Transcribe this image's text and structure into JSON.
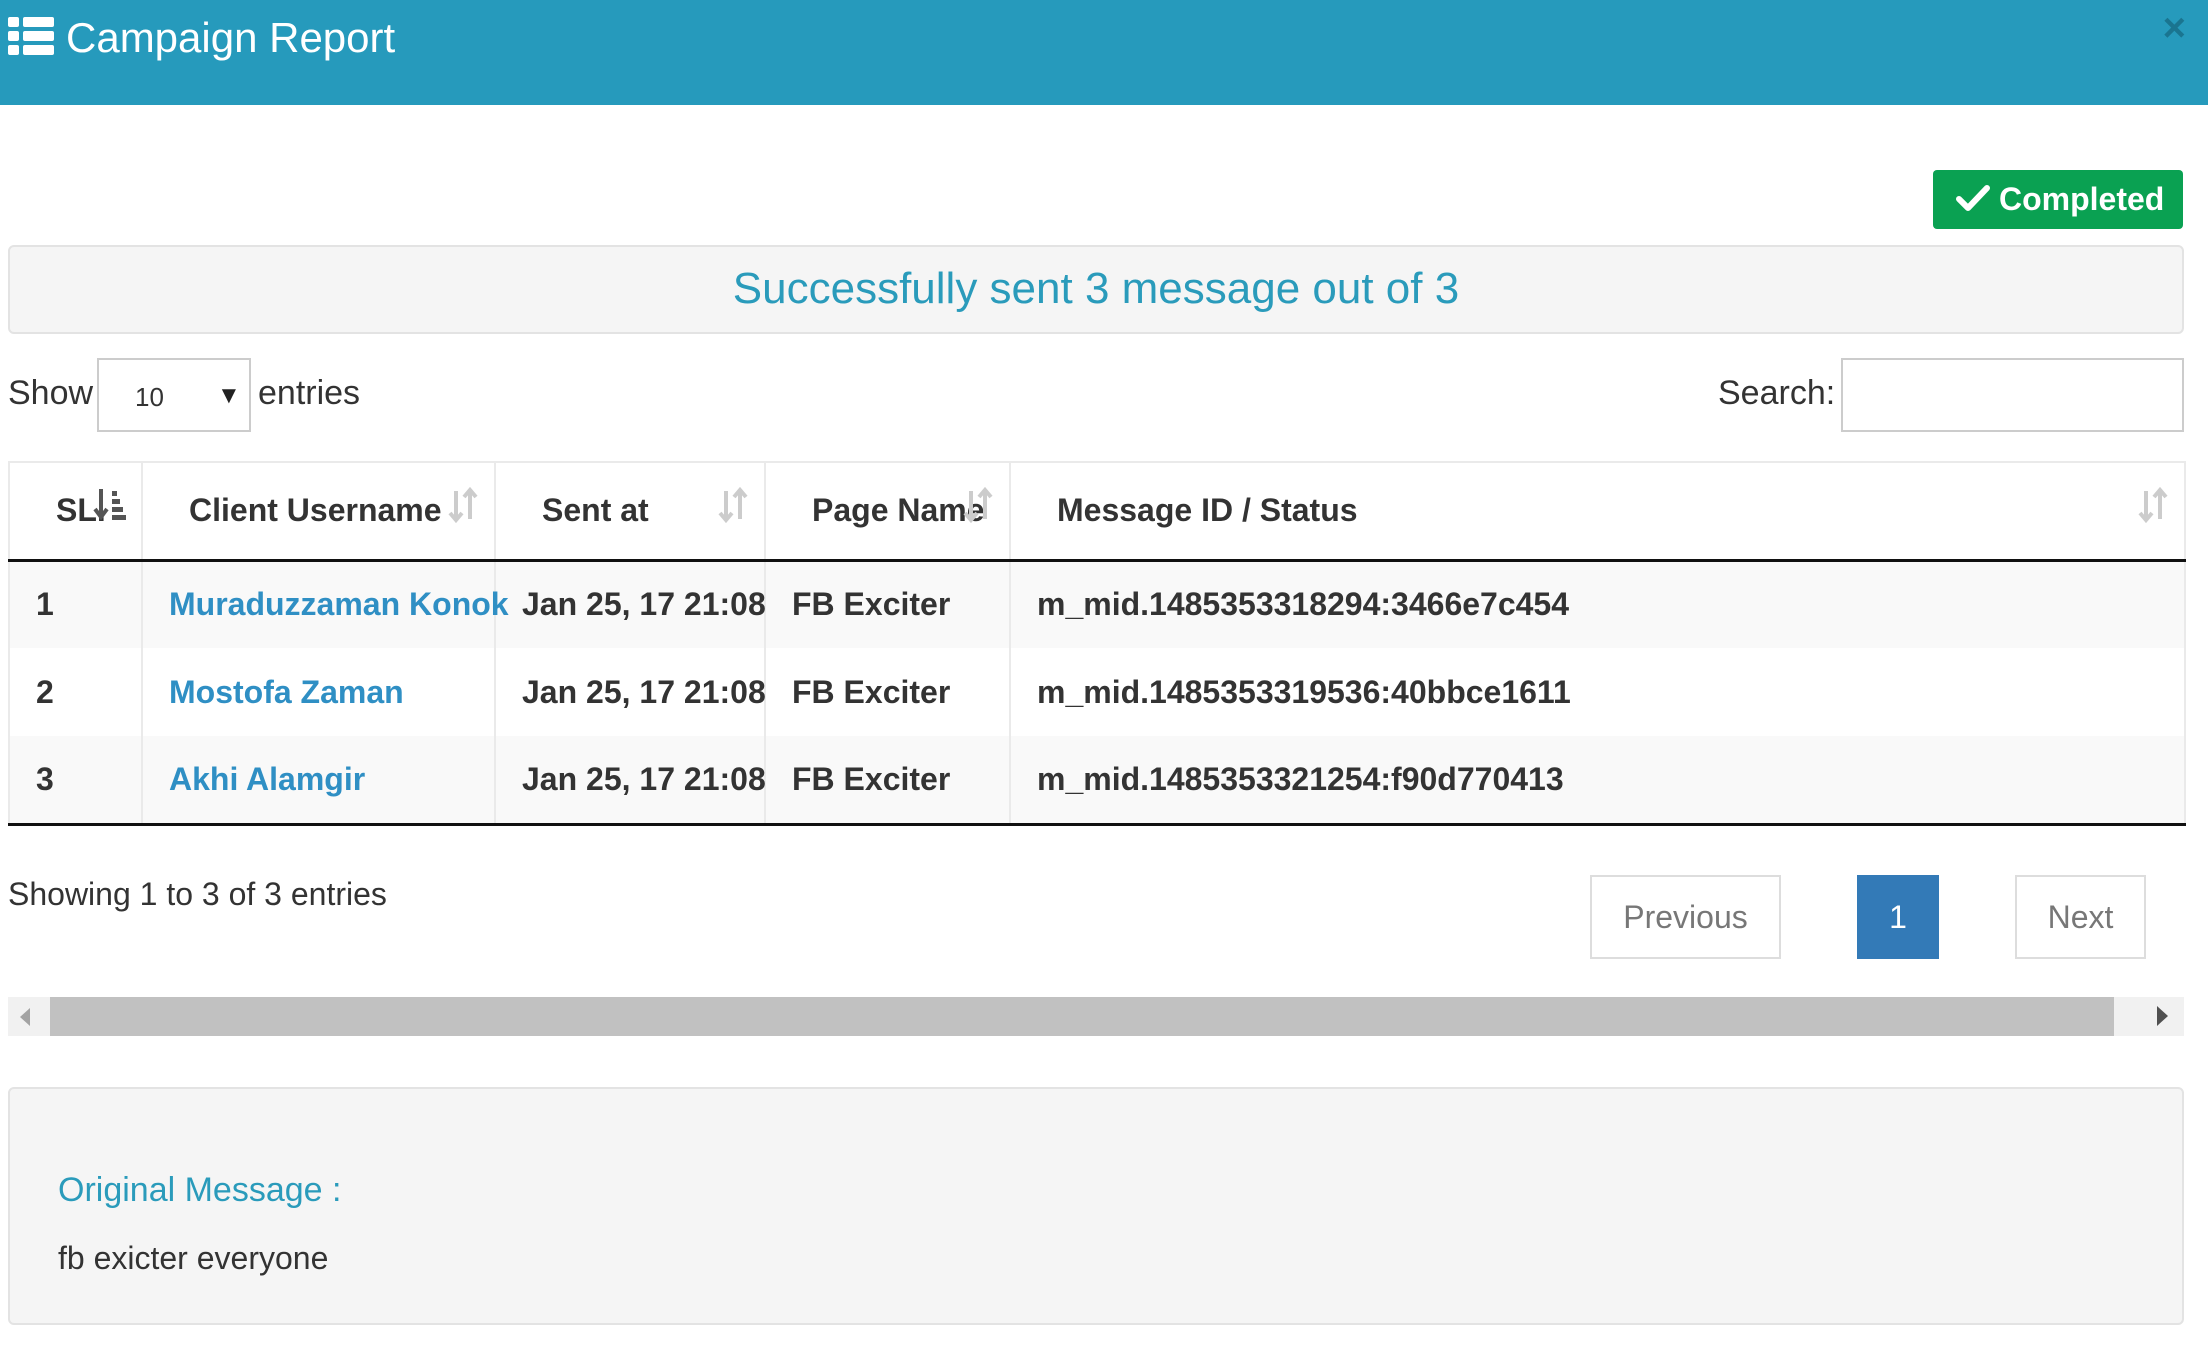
{
  "header": {
    "title": "Campaign Report",
    "close_label": "×"
  },
  "badge": {
    "label": "Completed"
  },
  "summary": "Successfully sent 3 message out of 3",
  "controls": {
    "show_label": "Show",
    "length_value": "10",
    "entries_label": "entries",
    "search_label": "Search:",
    "search_value": ""
  },
  "table": {
    "columns": [
      "SL.",
      "Client Username",
      "Sent at",
      "Page Name",
      "Message ID / Status"
    ],
    "rows": [
      [
        "1",
        "Muraduzzaman Konok",
        "Jan 25, 17 21:08",
        "FB Exciter",
        "m_mid.1485353318294:3466e7c454"
      ],
      [
        "2",
        "Mostofa Zaman",
        "Jan 25, 17 21:08",
        "FB Exciter",
        "m_mid.1485353319536:40bbce1611"
      ],
      [
        "3",
        "Akhi Alamgir",
        "Jan 25, 17 21:08",
        "FB Exciter",
        "m_mid.1485353321254:f90d770413"
      ]
    ]
  },
  "info": "Showing 1 to 3 of 3 entries",
  "pagination": {
    "previous": "Previous",
    "current": "1",
    "next": "Next"
  },
  "message": {
    "label": "Original Message :",
    "text": "fb exicter everyone"
  },
  "colors": {
    "header": "#269abc",
    "completed": "#0aa152",
    "link": "#2f8fc4",
    "active_page": "#337ab7"
  }
}
